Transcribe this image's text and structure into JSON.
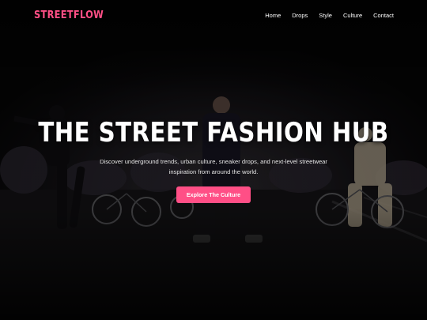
{
  "brand": {
    "logo": "STREETFLOW",
    "accent_color": "#ff4f86"
  },
  "nav": {
    "items": [
      {
        "label": "Home"
      },
      {
        "label": "Drops"
      },
      {
        "label": "Style"
      },
      {
        "label": "Culture"
      },
      {
        "label": "Contact"
      }
    ]
  },
  "hero": {
    "title": "THE STREET FASHION HUB",
    "subtitle": "Discover underground trends, urban culture, sneaker drops, and next-level streetwear inspiration from around the world.",
    "cta_label": "Explore The Culture",
    "background_image": "night street scene with dancers and bicycles"
  }
}
